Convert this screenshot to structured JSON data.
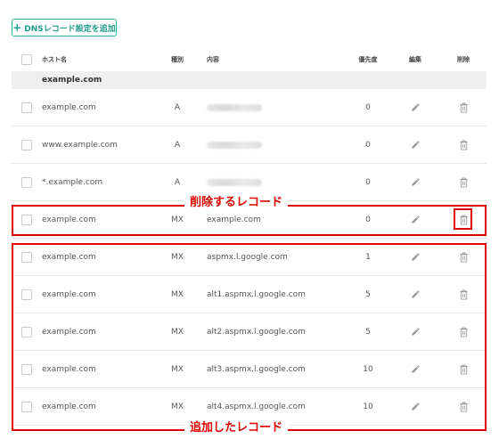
{
  "toolbar": {
    "add_label": "DNSレコード設定を追加"
  },
  "columns": {
    "host": "ホスト名",
    "type": "種別",
    "value": "内容",
    "priority": "優先度",
    "edit": "編集",
    "delete": "削除"
  },
  "group": {
    "domain": "example.com"
  },
  "rows": [
    {
      "host": "example.com",
      "type": "A",
      "value": "",
      "priority": "0",
      "value_masked": true
    },
    {
      "host": "www.example.com",
      "type": "A",
      "value": "",
      "priority": "0",
      "value_masked": true
    },
    {
      "host": "*.example.com",
      "type": "A",
      "value": "",
      "priority": "0",
      "value_masked": true
    },
    {
      "host": "example.com",
      "type": "MX",
      "value": "example.com",
      "priority": "0"
    },
    {
      "host": "example.com",
      "type": "MX",
      "value": "aspmx.l.google.com",
      "priority": "1"
    },
    {
      "host": "example.com",
      "type": "MX",
      "value": "alt1.aspmx.l.google.com",
      "priority": "5"
    },
    {
      "host": "example.com",
      "type": "MX",
      "value": "alt2.aspmx.l.google.com",
      "priority": "5"
    },
    {
      "host": "example.com",
      "type": "MX",
      "value": "alt3.aspmx.l.google.com",
      "priority": "10"
    },
    {
      "host": "example.com",
      "type": "MX",
      "value": "alt4.aspmx.l.google.com",
      "priority": "10"
    }
  ],
  "annotations": {
    "delete_record": "削除するレコード",
    "added_records": "追加したレコード",
    "highlight_color": "#e00000"
  },
  "colors": {
    "accent": "#2bb3a0",
    "group_bg": "#efefef"
  },
  "icons": {
    "add": "plus-icon",
    "edit": "pencil-icon",
    "delete": "trash-icon"
  }
}
